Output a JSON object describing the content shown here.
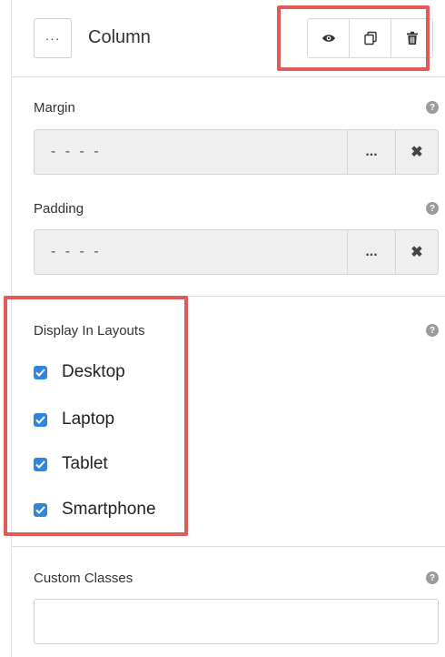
{
  "header": {
    "more_label": "···",
    "title": "Column"
  },
  "margin": {
    "label": "Margin",
    "value": "- - - -",
    "more_label": "...",
    "clear_label": "✖"
  },
  "padding": {
    "label": "Padding",
    "value": "- - - -",
    "more_label": "...",
    "clear_label": "✖"
  },
  "layouts": {
    "label": "Display In Layouts",
    "options": [
      {
        "label": "Desktop",
        "checked": true
      },
      {
        "label": "Laptop",
        "checked": true
      },
      {
        "label": "Tablet",
        "checked": true
      },
      {
        "label": "Smartphone",
        "checked": true
      }
    ]
  },
  "custom_classes": {
    "label": "Custom Classes",
    "value": ""
  },
  "help_glyph": "?",
  "colors": {
    "highlight": "#e05a5a",
    "checkbox": "#2f86e0"
  }
}
